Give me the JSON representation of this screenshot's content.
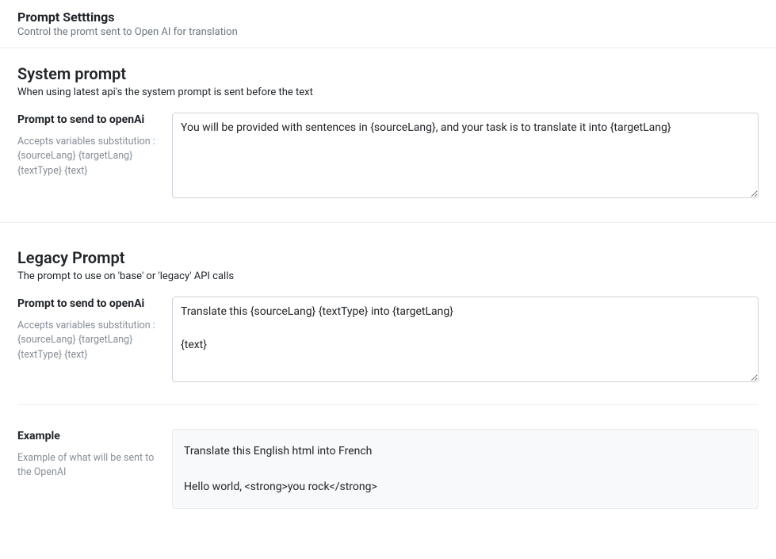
{
  "header": {
    "title": "Prompt Setttings",
    "subtitle": "Control the promt sent to Open AI for translation"
  },
  "system_section": {
    "title": "System prompt",
    "subtitle": "When using latest api's the system prompt is sent before the text",
    "field_label": "Prompt to send to openAi",
    "field_help": "Accepts variables substitution : {sourceLang} {targetLang} {textType} {text}",
    "value": "You will be provided with sentences in {sourceLang}, and your task is to translate it into {targetLang}"
  },
  "legacy_section": {
    "title": "Legacy Prompt",
    "subtitle": "The prompt to use on 'base' or 'legacy' API calls",
    "field_label": "Prompt to send to openAi",
    "field_help": "Accepts variables substitution : {sourceLang} {targetLang} {textType} {text}",
    "value": "Translate this {sourceLang} {textType} into {targetLang}\n\n{text}"
  },
  "example_section": {
    "field_label": "Example",
    "field_help": "Example of what will be sent to the OpenAI",
    "value": "Translate this English html into French\n\nHello world, <strong>you rock</strong>"
  }
}
